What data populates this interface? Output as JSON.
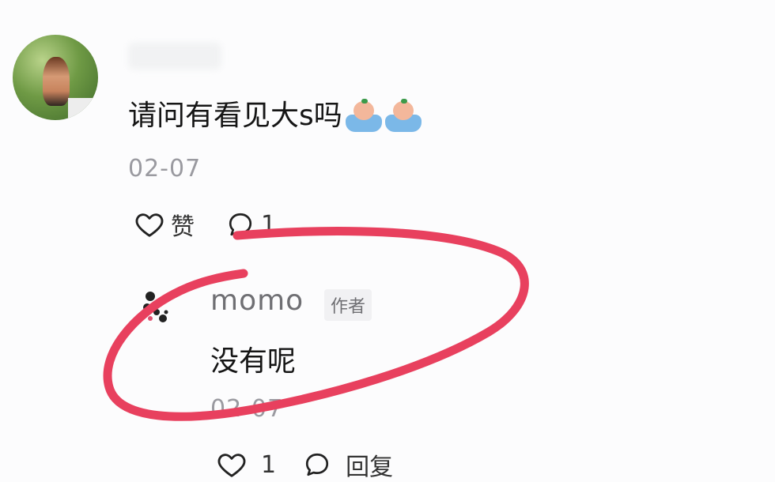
{
  "comment": {
    "text": "请问有看见大s吗",
    "emojis": [
      "bathtub-emoji",
      "bathtub-emoji"
    ],
    "date": "02-07",
    "like_label": "赞",
    "reply_count": "1"
  },
  "reply": {
    "author": "momo",
    "author_badge": "作者",
    "text": "没有呢",
    "date": "02-07",
    "like_count": "1",
    "reply_label": "回复"
  },
  "annotation": {
    "circle_color": "#e8405e"
  }
}
